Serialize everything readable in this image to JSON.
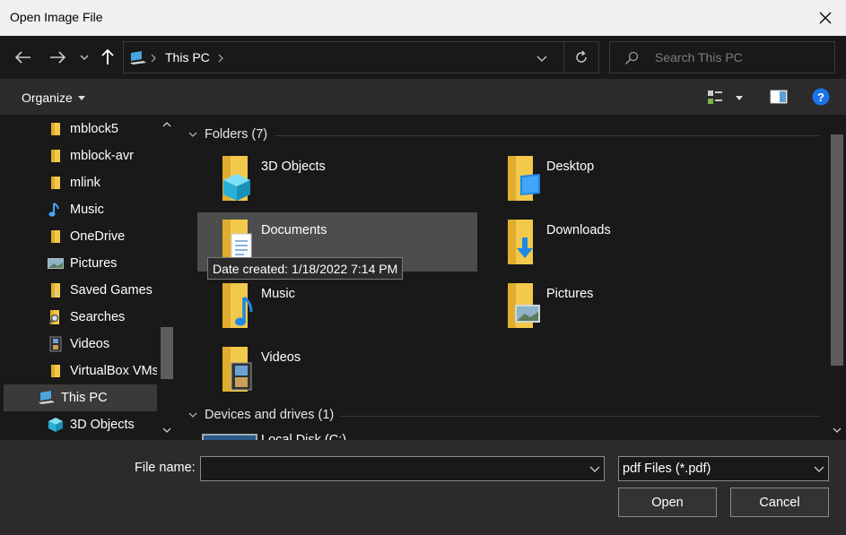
{
  "window": {
    "title": "Open Image File"
  },
  "address": {
    "location": "This PC"
  },
  "search": {
    "placeholder": "Search This PC"
  },
  "toolbar": {
    "organize_label": "Organize"
  },
  "tree": {
    "items": [
      {
        "label": "mblock5",
        "icon": "folder-icon"
      },
      {
        "label": "mblock-avr",
        "icon": "folder-icon"
      },
      {
        "label": "mlink",
        "icon": "folder-icon"
      },
      {
        "label": "Music",
        "icon": "music-note-icon"
      },
      {
        "label": "OneDrive",
        "icon": "folder-icon"
      },
      {
        "label": "Pictures",
        "icon": "pictures-icon"
      },
      {
        "label": "Saved Games",
        "icon": "saved-games-icon"
      },
      {
        "label": "Searches",
        "icon": "searches-icon"
      },
      {
        "label": "Videos",
        "icon": "videos-icon"
      },
      {
        "label": "VirtualBox VMs",
        "icon": "folder-icon"
      },
      {
        "label": "This PC",
        "icon": "this-pc-icon"
      },
      {
        "label": "3D Objects",
        "icon": "3d-objects-icon"
      }
    ]
  },
  "content": {
    "folders_header": "Folders (7)",
    "folders": [
      {
        "label": "3D Objects",
        "icon": "3d-objects-folder-icon"
      },
      {
        "label": "Desktop",
        "icon": "desktop-folder-icon"
      },
      {
        "label": "Documents",
        "icon": "documents-folder-icon"
      },
      {
        "label": "Downloads",
        "icon": "downloads-folder-icon"
      },
      {
        "label": "Music",
        "icon": "music-folder-icon"
      },
      {
        "label": "Pictures",
        "icon": "pictures-folder-icon"
      },
      {
        "label": "Videos",
        "icon": "videos-folder-icon"
      }
    ],
    "drives_header": "Devices and drives (1)",
    "drive_label": "Local Disk (C:)",
    "tooltip": "Date created: 1/18/2022 7:14 PM"
  },
  "bottom": {
    "file_name_label": "File name:",
    "file_name_value": "",
    "file_type": "pdf Files (*.pdf)",
    "open_label": "Open",
    "cancel_label": "Cancel"
  },
  "colors": {
    "folder": "#f2c94c",
    "accent": "#0078d7",
    "dark": "#191919"
  }
}
